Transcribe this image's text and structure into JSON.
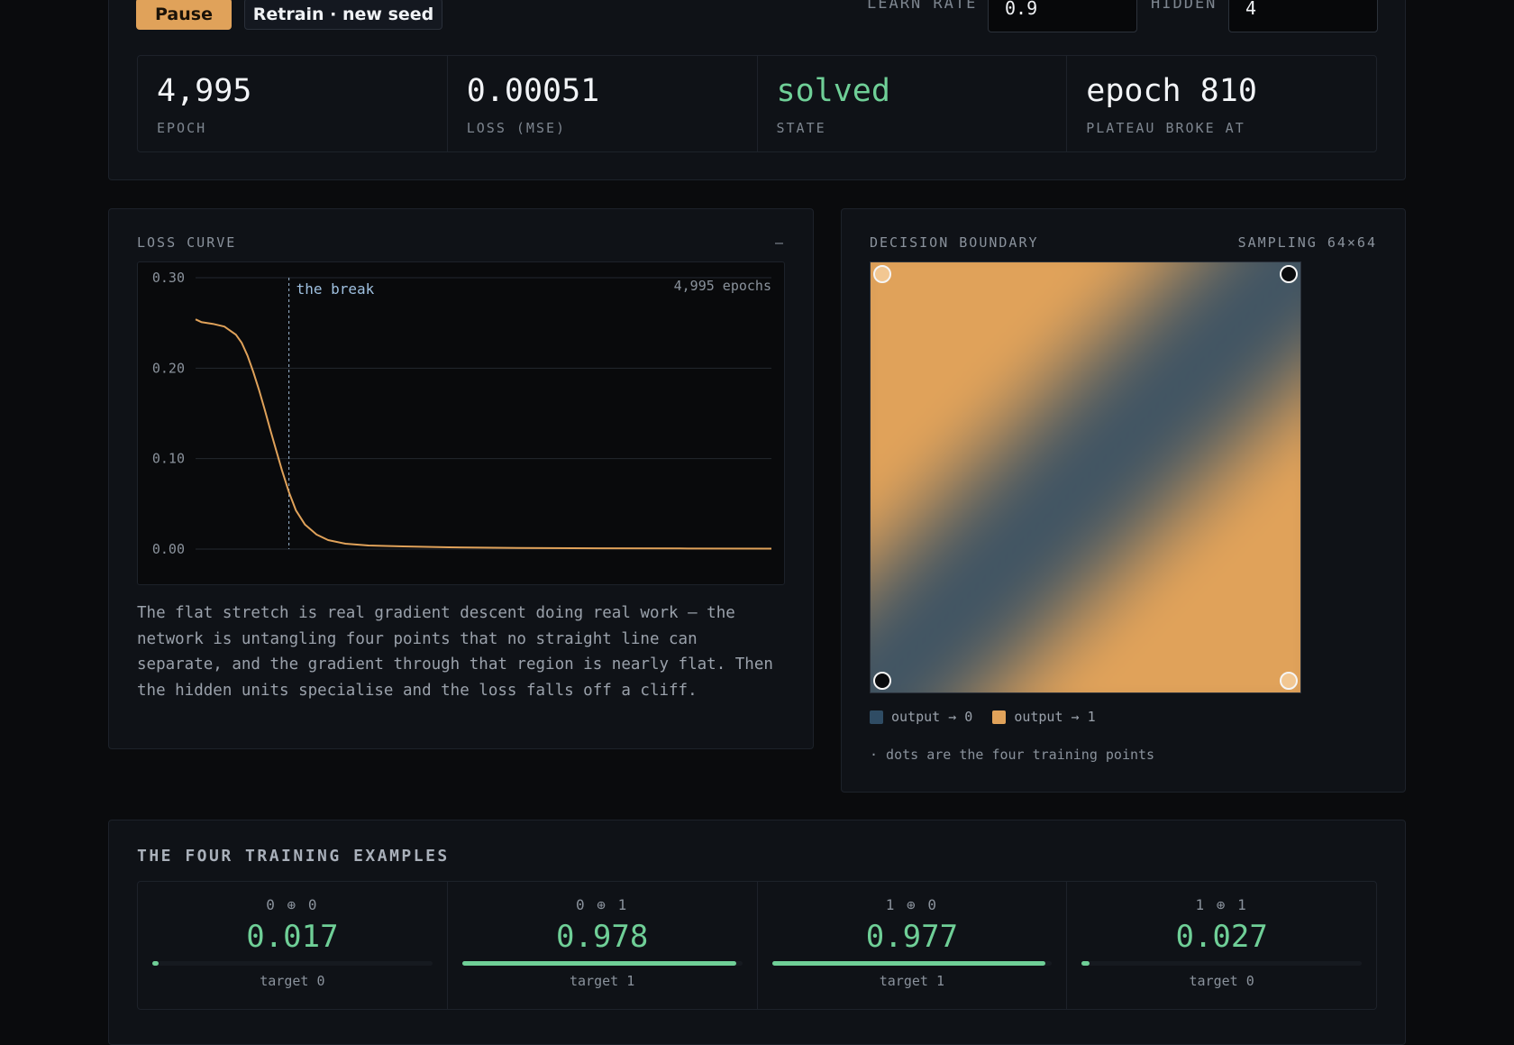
{
  "controls": {
    "pause_label": "Pause",
    "retrain_label": "Retrain · new seed",
    "learn_rate_label": "LEARN RATE",
    "learn_rate_value": "0.9",
    "hidden_label": "HIDDEN",
    "hidden_value": "4"
  },
  "stats": [
    {
      "value": "4,995",
      "label": "EPOCH"
    },
    {
      "value": "0.00051",
      "label": "LOSS (MSE)"
    },
    {
      "value": "solved",
      "label": "STATE"
    },
    {
      "value": "epoch 810",
      "label": "PLATEAU BROKE AT"
    }
  ],
  "loss_panel": {
    "title": "LOSS CURVE",
    "corner": "—",
    "description": "The flat stretch is real gradient descent doing real work — the network is untangling four points that no straight line can separate, and the gradient through that region is nearly flat. Then the hidden units specialise and the loss falls off a cliff."
  },
  "chart_data": {
    "type": "line",
    "title": "",
    "xlabel": "",
    "ylabel": "",
    "ylim": [
      0,
      0.3
    ],
    "xlim": [
      0,
      4995
    ],
    "yticks": [
      "0.30",
      "0.20",
      "0.10",
      "0.00"
    ],
    "ytick_values": [
      0.3,
      0.2,
      0.1,
      0.0
    ],
    "grid": true,
    "annotation_break": {
      "label": "the break",
      "x": 810
    },
    "annotation_epochs": "4,995 epochs",
    "series": [
      {
        "color": "#e0a25a",
        "x": [
          0,
          50,
          150,
          250,
          350,
          400,
          450,
          500,
          550,
          600,
          650,
          700,
          750,
          810,
          870,
          950,
          1050,
          1150,
          1300,
          1500,
          1800,
          2200,
          2800,
          3500,
          4200,
          4995
        ],
        "y": [
          0.254,
          0.251,
          0.249,
          0.246,
          0.237,
          0.228,
          0.214,
          0.196,
          0.176,
          0.154,
          0.131,
          0.109,
          0.087,
          0.063,
          0.043,
          0.027,
          0.016,
          0.01,
          0.006,
          0.004,
          0.003,
          0.002,
          0.0012,
          0.0009,
          0.0007,
          0.0005
        ]
      }
    ]
  },
  "boundary_panel": {
    "title": "DECISION BOUNDARY",
    "sampling": "SAMPLING 64×64",
    "legend": [
      {
        "label": "output → 0",
        "color": "#2f4c64"
      },
      {
        "label": "output → 1",
        "color": "#e0a25a"
      }
    ],
    "footnote": "· dots are the four training points",
    "low_color": "#2f4c64",
    "high_color": "#e0a25a"
  },
  "examples": {
    "title": "THE FOUR TRAINING EXAMPLES",
    "items": [
      {
        "input": "0 ⊕ 0",
        "output": "0.017",
        "output_value": 0.017,
        "target": "target 0"
      },
      {
        "input": "0 ⊕ 1",
        "output": "0.978",
        "output_value": 0.978,
        "target": "target 1"
      },
      {
        "input": "1 ⊕ 0",
        "output": "0.977",
        "output_value": 0.977,
        "target": "target 1"
      },
      {
        "input": "1 ⊕ 1",
        "output": "0.027",
        "output_value": 0.027,
        "target": "target 0"
      }
    ]
  }
}
